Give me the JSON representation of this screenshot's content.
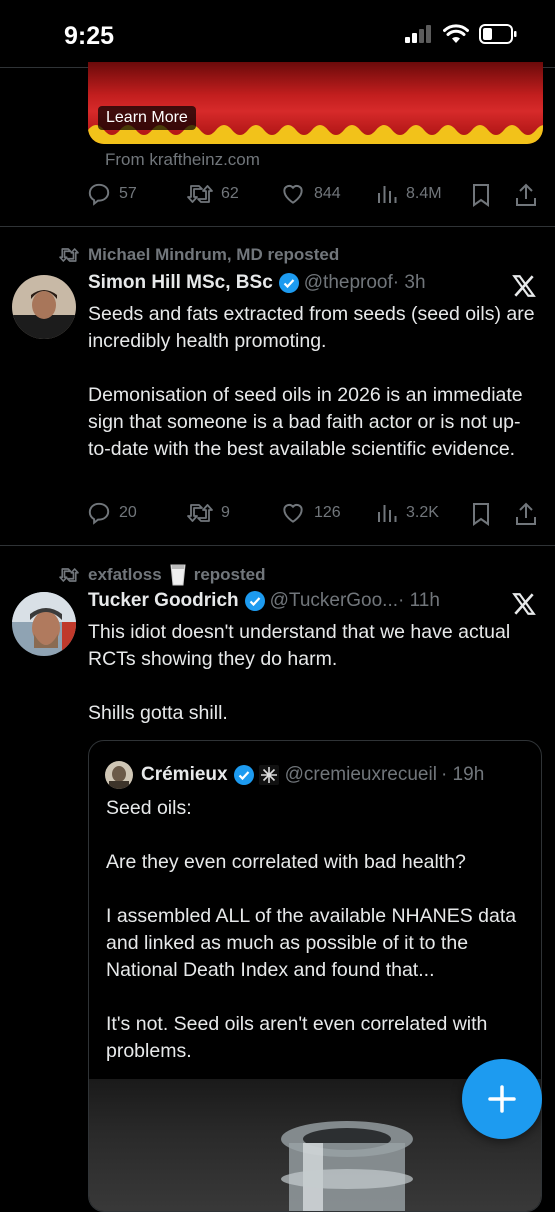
{
  "status_bar": {
    "time": "9:25"
  },
  "ad": {
    "learn_more": "Learn More",
    "source": "From kraftheinz.com"
  },
  "ad_actions": {
    "replies": "57",
    "reposts": "62",
    "likes": "844",
    "views": "8.4M"
  },
  "tweet1": {
    "repost_by": "Michael Mindrum, MD reposted",
    "name": "Simon Hill MSc, BSc",
    "handle": "@theproof",
    "time": "· 3h",
    "text": "Seeds and fats extracted from seeds (seed oils) are incredibly health promoting.\n\nDemonisation of seed oils in 2026 is an immediate sign that someone is a bad faith actor or is not up-to-date with the best available scientific evidence.",
    "replies": "20",
    "reposts": "9",
    "likes": "126",
    "views": "3.2K"
  },
  "tweet2": {
    "repost_by": "exfatloss",
    "repost_suffix": "reposted",
    "name": "Tucker Goodrich",
    "handle": "@TuckerGoo...",
    "time": "· 11h",
    "text": "This idiot doesn't understand that we have actual RCTs showing they do harm.\n\nShills gotta shill.",
    "quote": {
      "name": "Crémieux",
      "handle": "@cremieuxrecueil",
      "time": "· 19h",
      "text": "Seed oils:\n\nAre they even correlated with bad health?\n\nI assembled ALL of the available NHANES data and linked as much as possible of it to the National Death Index and found that...\n\nIt's not. Seed oils aren't even correlated with problems."
    }
  },
  "colors": {
    "accent": "#1d9bf0",
    "muted": "#71767b",
    "text": "#e7e9ea",
    "background": "#000000"
  },
  "icons": [
    "signal-icon",
    "wifi-icon",
    "battery-icon",
    "reply-icon",
    "repost-icon",
    "like-icon",
    "views-icon",
    "bookmark-icon",
    "share-icon",
    "verified-icon",
    "x-logo-icon",
    "compose-plus-icon",
    "milk-glass-icon",
    "snowflake-badge-icon"
  ]
}
